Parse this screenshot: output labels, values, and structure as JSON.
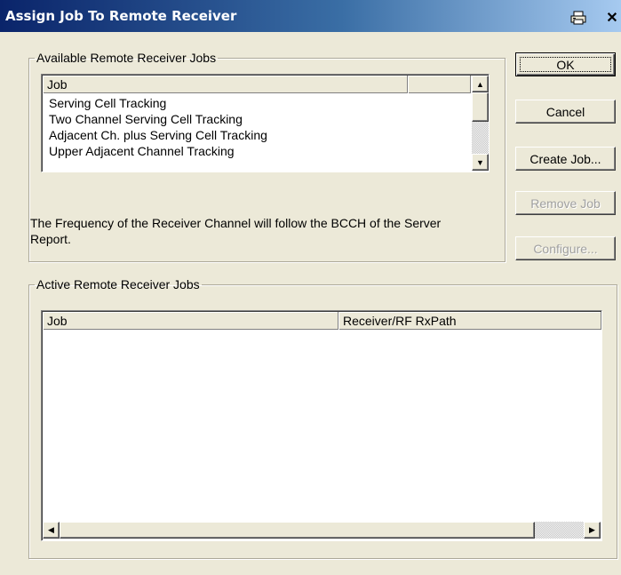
{
  "window": {
    "title": "Assign Job To Remote Receiver",
    "icons": {
      "print": "printer-icon",
      "close": "close-icon"
    }
  },
  "available_group": {
    "legend": "Available Remote Receiver Jobs",
    "columns": [
      "Job",
      ""
    ],
    "rows": [
      "Serving Cell Tracking",
      "Two Channel Serving Cell Tracking",
      "Adjacent Ch. plus Serving Cell Tracking",
      "Upper Adjacent Channel Tracking"
    ],
    "description": "The Frequency of the Receiver Channel will follow the BCCH of the Server Report."
  },
  "buttons": {
    "ok": "OK",
    "cancel": "Cancel",
    "create_job": "Create Job...",
    "remove_job": "Remove Job",
    "configure": "Configure..."
  },
  "active_group": {
    "legend": "Active Remote Receiver Jobs",
    "columns": [
      "Job",
      "Receiver/RF RxPath"
    ],
    "rows": []
  },
  "colors": {
    "dialog_bg": "#ece9d8",
    "title_bar_start": "#0a246a",
    "title_bar_end": "#a6caf0",
    "disabled_text": "#a0a0a0"
  }
}
